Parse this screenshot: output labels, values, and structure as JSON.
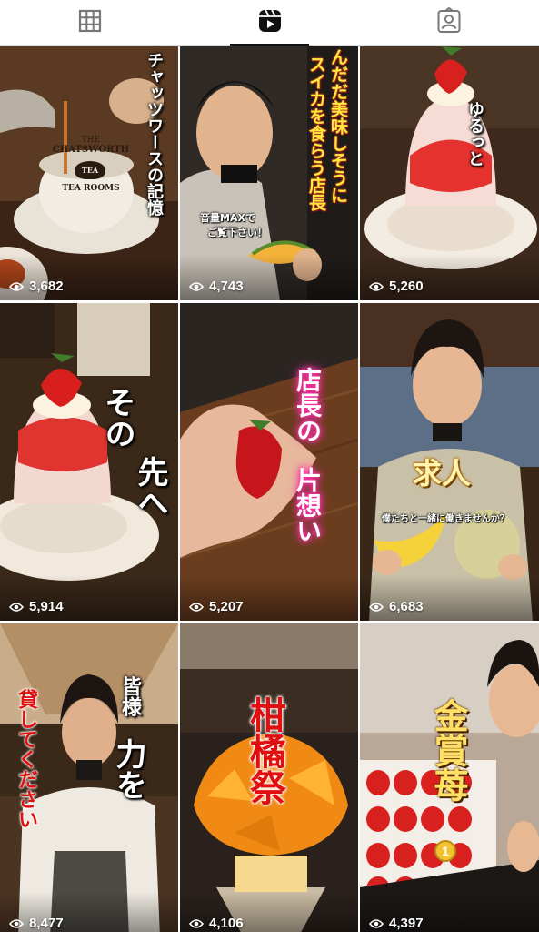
{
  "tabs": [
    {
      "name": "grid",
      "icon": "grid-icon",
      "active": false
    },
    {
      "name": "reels",
      "icon": "reels-icon",
      "active": true
    },
    {
      "name": "tagged",
      "icon": "tagged-icon",
      "active": false
    }
  ],
  "reels": [
    {
      "views": "3,682",
      "caption": "チャッツワースの記憶",
      "logo": {
        "line1": "THE",
        "line2": "CHATSWORTH",
        "center": "TEA",
        "line3": "TEA ROOMS"
      }
    },
    {
      "views": "4,743",
      "caption_lines": [
        "んだだ美味しそうに",
        "スイカを食らう店長"
      ],
      "note_lines": [
        "音量MAXで",
        "ご覧下さい！"
      ]
    },
    {
      "views": "5,260",
      "caption": "ゆるっと"
    },
    {
      "views": "5,914",
      "caption_lines": [
        "その",
        "先へ"
      ]
    },
    {
      "views": "5,207",
      "caption_lines": [
        "店長の",
        "片想い"
      ]
    },
    {
      "views": "6,683",
      "caption": "求人",
      "subcaption": "僕たちと一緒に働きませんか？"
    },
    {
      "views": "8,477",
      "caption_lines": [
        "皆様",
        "力を",
        "貸してください"
      ]
    },
    {
      "views": "4,106",
      "caption": "柑橘祭"
    },
    {
      "views": "4,397",
      "caption": "金賞苺",
      "medal": "1"
    }
  ]
}
